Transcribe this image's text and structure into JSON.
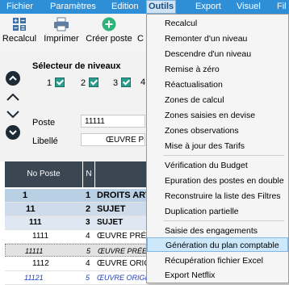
{
  "menubar": {
    "items": [
      "Fichier",
      "Paramètres",
      "Edition",
      "Outils",
      "Export",
      "Visuel",
      "Fil"
    ],
    "active": "Outils"
  },
  "toolbar": {
    "buttons": [
      "Recalcul",
      "Imprimer",
      "Créer poste",
      "C"
    ]
  },
  "nav": {
    "selector_title": "Sélecteur de niveaux",
    "levels": [
      "1",
      "2",
      "3",
      "4"
    ],
    "poste_label": "Poste",
    "poste_value": "11111",
    "libelle_label": "Libellé",
    "libelle_value": "ŒUVRE PRI"
  },
  "grid": {
    "headers": [
      "No Poste",
      "N"
    ],
    "rows": [
      {
        "poste": "1",
        "n": "1",
        "label": "DROITS ART",
        "style": "lvl1"
      },
      {
        "poste": "11",
        "n": "2",
        "label": "SUJET",
        "style": "lvl2"
      },
      {
        "poste": "111",
        "n": "3",
        "label": "SUJET",
        "style": "lvl3"
      },
      {
        "poste": "1111",
        "n": "4",
        "label": "ŒUVRE PRÉE",
        "style": "normal"
      },
      {
        "poste": "11111",
        "n": "5",
        "label": "ŒUVRE PRÉEXIS",
        "style": "italic"
      },
      {
        "poste": "1112",
        "n": "4",
        "label": "ŒUVRE ORIGI",
        "style": "normal"
      },
      {
        "poste": "11121",
        "n": "5",
        "label": "ŒUVRE ORIGINA",
        "style": "italic-blue"
      }
    ]
  },
  "menu": {
    "items": [
      "Recalcul",
      "Remonter d'un niveau",
      "Descendre d'un niveau",
      "Remise à zéro",
      "Réactualisation",
      "Zones de calcul",
      "Zones saisies en devise",
      "Zones observations",
      "Mise à jour des Tarifs",
      "Vérification du Budget",
      "Epuration des postes en double",
      "Reconstruire la liste des Filtres",
      "Duplication partielle",
      "Saisie des engagements",
      "Génération du plan comptable",
      "Récupération fichier Excel",
      "Export Netflix"
    ],
    "highlighted": "Génération du plan comptable"
  },
  "colors": {
    "menubar": "#2e8fd6",
    "checkbox": "#2a9d8f",
    "grid_header": "#3a4652",
    "highlight": "#cde8fb"
  }
}
